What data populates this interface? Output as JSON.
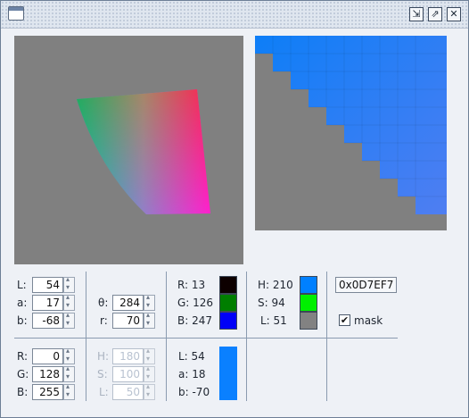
{
  "titlebar": {
    "minimize_glyph": "⇲",
    "maximize_glyph": "⇗",
    "close_glyph": "✕"
  },
  "lab": {
    "L": {
      "label": "L:",
      "value": "54"
    },
    "a": {
      "label": "a:",
      "value": "17"
    },
    "b": {
      "label": "b:",
      "value": "-68"
    }
  },
  "polar": {
    "theta": {
      "label": "θ:",
      "value": "284"
    },
    "r": {
      "label": "r:",
      "value": "70"
    }
  },
  "rgb_display": {
    "R": "R: 13",
    "G": "G: 126",
    "B": "B: 247",
    "colors": {
      "R": "#0d0000",
      "G": "#007e00",
      "B": "#0000f7"
    }
  },
  "hsl_display": {
    "H": "H: 210",
    "S": "S: 94",
    "L": "L: 51",
    "colors": {
      "H": "#0080ff",
      "S": "#00f000",
      "L": "#828282"
    }
  },
  "hex": "0x0D7EF7",
  "mask": {
    "label": "mask",
    "checked": true,
    "check_glyph": "✔"
  },
  "rgb_input": {
    "R": {
      "label": "R:",
      "value": "0"
    },
    "G": {
      "label": "G:",
      "value": "128"
    },
    "B": {
      "label": "B:",
      "value": "255"
    }
  },
  "hsl_input_disabled": {
    "H": {
      "label": "H:",
      "value": "180"
    },
    "S": {
      "label": "S:",
      "value": "100"
    },
    "L": {
      "label": "L:",
      "value": "50"
    }
  },
  "lab_result": {
    "L": "L: 54",
    "a": "a: 18",
    "b": "b: -70",
    "color": "#0a80ff"
  },
  "colors": {
    "panel_gray": "#808080",
    "accent_blue": "#0d7ef7",
    "selected_blue": "#0080ff",
    "gradient_edge": "#4e7ef0"
  }
}
